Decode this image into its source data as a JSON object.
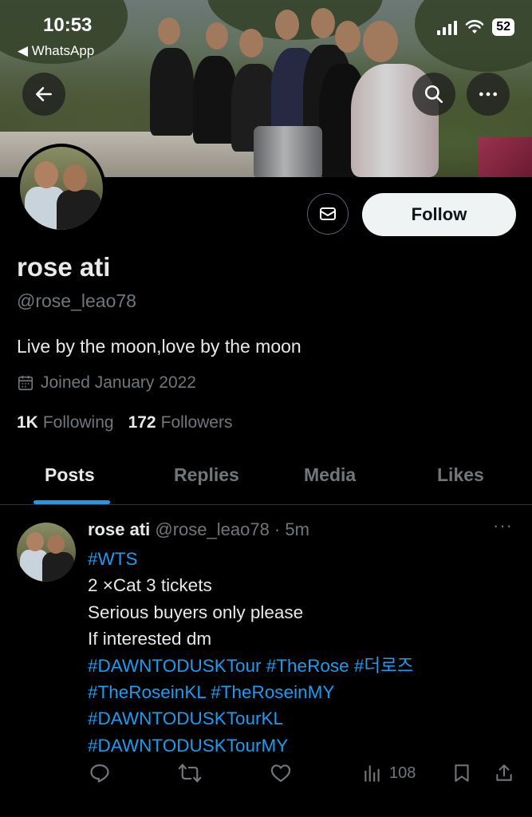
{
  "status_bar": {
    "time": "10:53",
    "back_app": "◀ WhatsApp",
    "battery": "52"
  },
  "header": {
    "back_icon": "arrow-left-icon",
    "search_icon": "search-icon",
    "more_icon": "more-icon"
  },
  "profile": {
    "display_name": "rose ati",
    "handle": "@rose_leao78",
    "bio": "Live by the moon,love by the moon",
    "joined": "Joined January 2022",
    "following_count": "1K",
    "following_label": "Following",
    "followers_count": "172",
    "followers_label": "Followers",
    "follow_label": "Follow"
  },
  "tabs": [
    {
      "label": "Posts",
      "active": true
    },
    {
      "label": "Replies",
      "active": false
    },
    {
      "label": "Media",
      "active": false
    },
    {
      "label": "Likes",
      "active": false
    }
  ],
  "post": {
    "author": "rose ati",
    "meta": "@rose_leao78 · 5m",
    "more": "···",
    "lines": [
      {
        "text": "#WTS",
        "tag": true
      },
      {
        "text": "2 ×Cat 3 tickets",
        "tag": false
      },
      {
        "text": "Serious buyers only please",
        "tag": false
      },
      {
        "text": "If interested dm",
        "tag": false
      },
      {
        "text": "#DAWNTODUSKTour #TheRose #더로즈",
        "tag": true
      },
      {
        "text": "#TheRoseinKL #TheRoseinMY",
        "tag": true
      },
      {
        "text": "#DAWNTODUSKTourKL",
        "tag": true
      },
      {
        "text": "#DAWNTODUSKTourMY",
        "tag": true
      }
    ],
    "views": "108"
  },
  "colors": {
    "accent": "#1d9bf0",
    "muted": "#71767b",
    "text": "#e7e9ea",
    "background": "#000000"
  }
}
